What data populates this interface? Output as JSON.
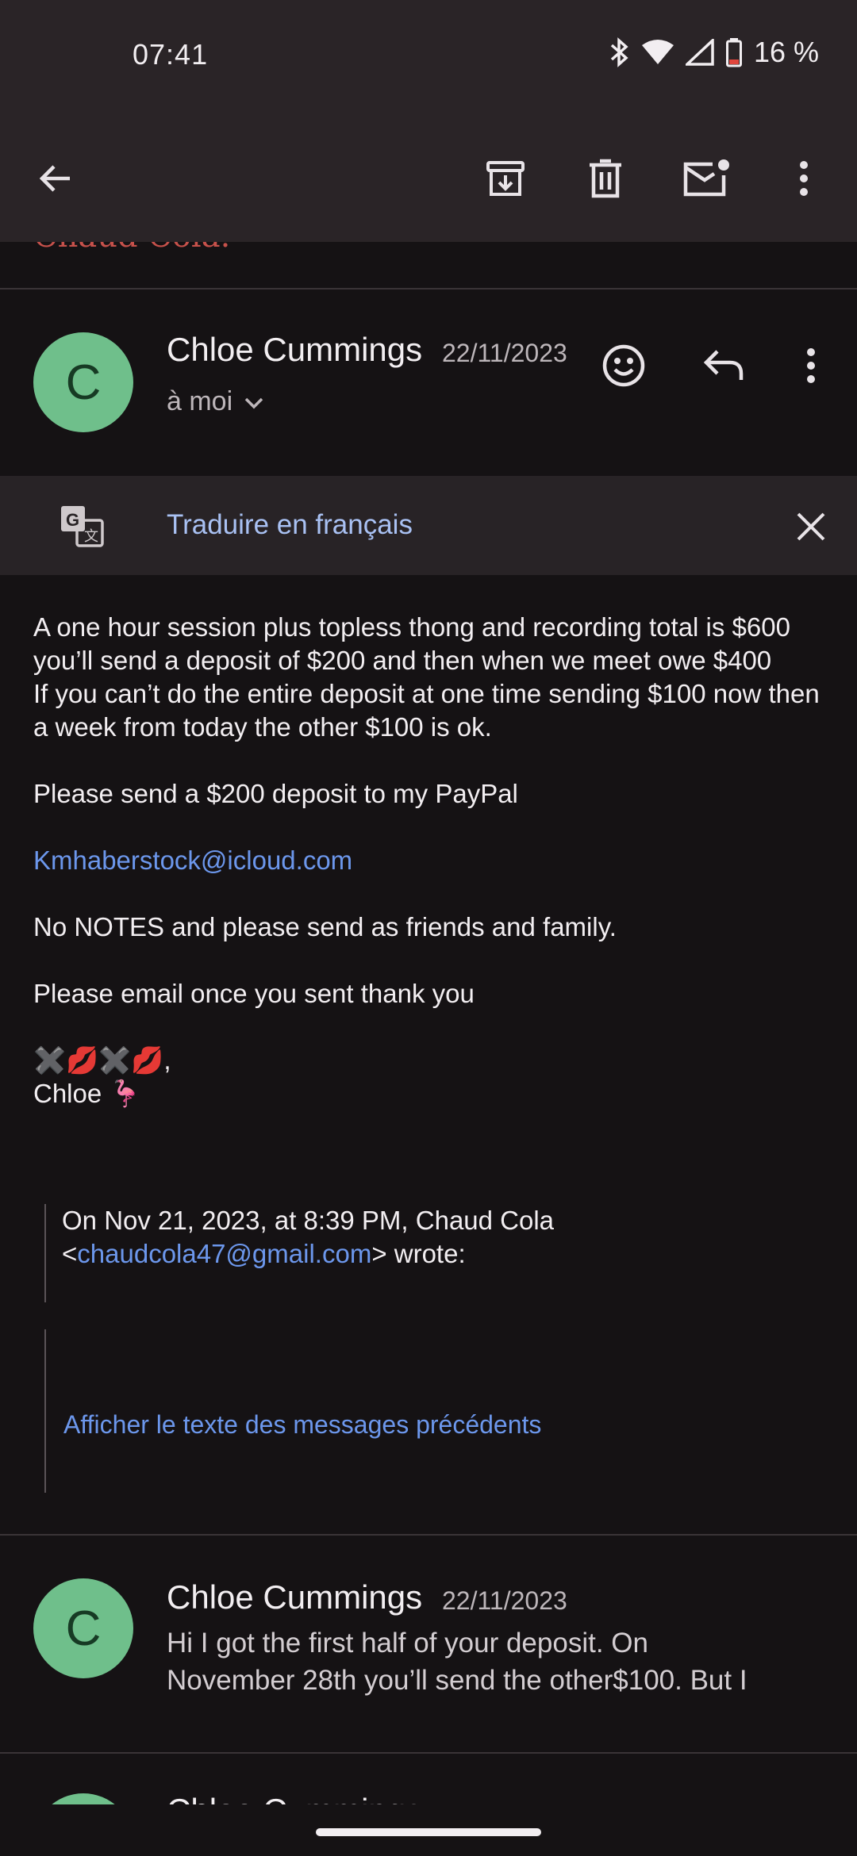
{
  "status_bar": {
    "time": "07:41",
    "battery": "16 %"
  },
  "toolbar": {
    "icons": [
      "back-arrow-icon",
      "archive-icon",
      "delete-icon",
      "mark-unread-icon",
      "more-vert-icon"
    ]
  },
  "previous_message_peek": {
    "text": "Chaud Cola."
  },
  "message": {
    "avatar_letter": "C",
    "sender": "Chloe Cummings",
    "date": "22/11/2023",
    "to_label": "à moi",
    "translate_label": "Traduire en français",
    "body": {
      "p1": "A one hour session plus topless thong and recording total is $600 you’ll send a deposit of $200 and then when we meet owe $400",
      "p2": "If you can’t do the entire deposit at one time sending $100 now then a week from today the other $100 is ok.",
      "p3": "Please send a $200 deposit to my PayPal",
      "email_link": "Kmhaberstock@icloud.com",
      "p4": "No NOTES and please send as friends and family.",
      "p5": "Please email once you sent thank you",
      "sign_emoji": "✖️💋✖️💋,",
      "sign_name": "Chloe 🦩"
    },
    "quote": {
      "line1": "On Nov 21, 2023, at 8:39 PM, Chaud Cola",
      "open_bracket": "<",
      "email": "chaudcola47@gmail.com",
      "suffix": "> wrote:",
      "show_previous": "Afficher le texte des messages précédents"
    }
  },
  "next_message": {
    "avatar_letter": "C",
    "sender": "Chloe Cummings",
    "date": "22/11/2023",
    "snippet_line1": "Hi I got the first half of your deposit. On",
    "snippet_line2": "November 28th you’ll send the other$100. But I"
  },
  "third_message_peek": {
    "sender": "Chloe Cummings"
  }
}
